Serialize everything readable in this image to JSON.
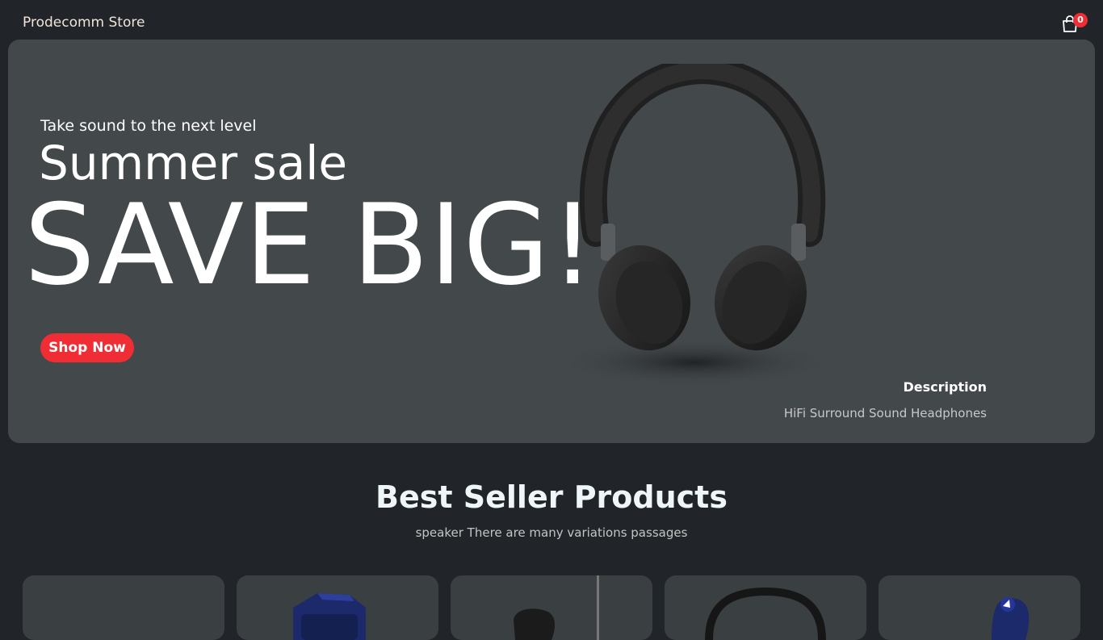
{
  "navbar": {
    "brand": "Prodecomm Store",
    "cart_count": "0"
  },
  "hero": {
    "small_text": "Take sound to the next level",
    "mid_text": "Summer sale",
    "large_text": "SAVE BIG!",
    "button_label": "Shop Now",
    "description_title": "Description",
    "description_text": "HiFi Surround Sound Headphones"
  },
  "best_seller": {
    "title": "Best Seller Products",
    "subtitle": "speaker There are many variations passages"
  },
  "products": [
    {
      "image": "blank"
    },
    {
      "image": "vr-headset"
    },
    {
      "image": "earbuds"
    },
    {
      "image": "headphones"
    },
    {
      "image": "speaker"
    }
  ],
  "colors": {
    "background": "#212529",
    "hero": "#43484b",
    "accent": "#f02d34",
    "card": "#3a3f42"
  }
}
